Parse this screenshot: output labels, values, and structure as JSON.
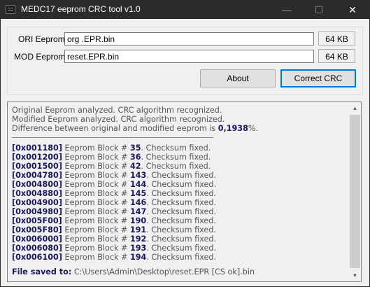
{
  "window": {
    "title": "MEDC17 eeprom CRC tool  v1.0"
  },
  "ori": {
    "label": "ORI Eeprom:",
    "value": "org .EPR.bin",
    "size": "64 KB"
  },
  "mod": {
    "label": "MOD Eeprom:",
    "value": "reset.EPR.bin",
    "size": "64 KB"
  },
  "buttons": {
    "about": "About",
    "correct": "Correct CRC"
  },
  "log": {
    "analysis": [
      "Original Eeprom analyzed. CRC algorithm recognized.",
      "Modified Eeprom analyzed. CRC algorithm recognized."
    ],
    "diff_prefix": "Difference between original and modified eeprom is ",
    "diff_value": "0,1938",
    "diff_suffix": "%.",
    "block_label": "Eeprom Block # ",
    "fixed_text": ". Checksum fixed.",
    "entries": [
      {
        "addr": "[0x001180]",
        "block": "35"
      },
      {
        "addr": "[0x001200]",
        "block": "36"
      },
      {
        "addr": "[0x001500]",
        "block": "42"
      },
      {
        "addr": "[0x004780]",
        "block": "143"
      },
      {
        "addr": "[0x004800]",
        "block": "144"
      },
      {
        "addr": "[0x004880]",
        "block": "145"
      },
      {
        "addr": "[0x004900]",
        "block": "146"
      },
      {
        "addr": "[0x004980]",
        "block": "147"
      },
      {
        "addr": "[0x005F00]",
        "block": "190"
      },
      {
        "addr": "[0x005F80]",
        "block": "191"
      },
      {
        "addr": "[0x006000]",
        "block": "192"
      },
      {
        "addr": "[0x006080]",
        "block": "193"
      },
      {
        "addr": "[0x006100]",
        "block": "194"
      }
    ],
    "saved_label": "File saved to:",
    "saved_path": " C:\\Users\\Admin\\Desktop\\reset.EPR [CS  ok].bin"
  }
}
